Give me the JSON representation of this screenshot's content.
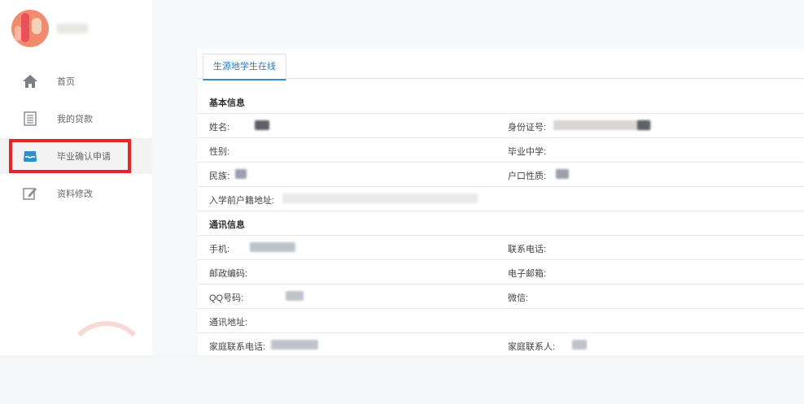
{
  "sidebar": {
    "items": [
      {
        "label": "首页",
        "icon": "home-icon"
      },
      {
        "label": "我的贷款",
        "icon": "list-icon"
      },
      {
        "label": "毕业确认申请",
        "icon": "inbox-icon"
      },
      {
        "label": "资料修改",
        "icon": "edit-icon"
      }
    ]
  },
  "tab": {
    "label": "生源地学生在线"
  },
  "sections": {
    "basic": {
      "title": "基本信息",
      "name_label": "姓名:",
      "id_label": "身份证号:",
      "gender_label": "性别:",
      "school_label": "毕业中学:",
      "ethnicity_label": "民族:",
      "hukou_label": "户口性质:",
      "address_label": "入学前户籍地址:"
    },
    "contact": {
      "title": "通讯信息",
      "mobile_label": "手机:",
      "phone_label": "联系电话:",
      "postcode_label": "邮政编码:",
      "email_label": "电子邮箱:",
      "qq_label": "QQ号码:",
      "wechat_label": "微信:",
      "mail_address_label": "通讯地址:",
      "family_phone_label": "家庭联系电话:",
      "family_contact_label": "家庭联系人:"
    }
  },
  "colors": {
    "accent": "#2b8fd0",
    "highlight": "#e8242a"
  }
}
